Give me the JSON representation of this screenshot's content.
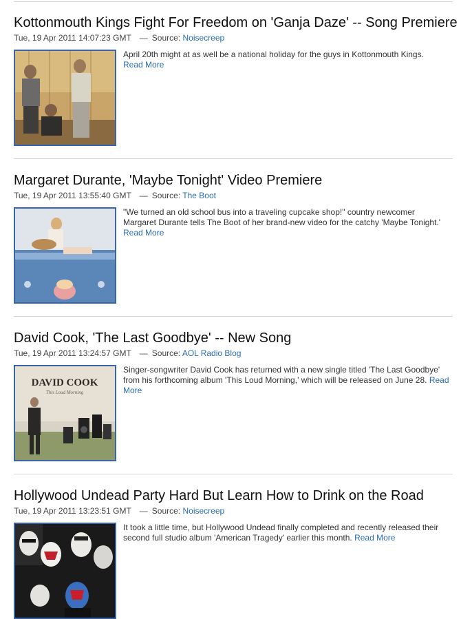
{
  "articles": [
    {
      "title": "Kottonmouth Kings Fight For Freedom on 'Ganja Daze' -- Song Premiere",
      "date": "Tue, 19 Apr 2011 14:07:23 GMT",
      "source_label": "Source:",
      "source": "Noisecreep",
      "summary": "April 20th might at as well be a national holiday for the guys in Kottonmouth Kings.",
      "read_more": "Read More"
    },
    {
      "title": "Margaret Durante, 'Maybe Tonight' Video Premiere",
      "date": "Tue, 19 Apr 2011 13:55:40 GMT",
      "source_label": "Source:",
      "source": "The Boot",
      "summary": "\"We turned an old school bus into a traveling cupcake shop!\" country newcomer Margaret Durante tells The Boot of her brand-new video for the catchy 'Maybe Tonight.'",
      "read_more": "Read More"
    },
    {
      "title": "David Cook, 'The Last Goodbye' -- New Song",
      "date": "Tue, 19 Apr 2011 13:24:57 GMT",
      "source_label": "Source:",
      "source": "AOL Radio Blog",
      "summary": "Singer-songwriter David Cook has returned with a new single titled 'The Last Goodbye' from his forthcoming album 'This Loud Morning,' which will be released on June 28.",
      "read_more": "Read More",
      "album_art_text": "DAVID COOK",
      "album_art_subtext": "This Loud Morning"
    },
    {
      "title": "Hollywood Undead Party Hard But Learn How to Drink on the Road",
      "date": "Tue, 19 Apr 2011 13:23:51 GMT",
      "source_label": "Source:",
      "source": "Noisecreep",
      "summary": "It took a little time, but Hollywood Undead finally completed and recently released their second full studio album 'American Tragedy' earlier this month.",
      "read_more": "Read More"
    }
  ],
  "separator": "—",
  "colors": {
    "link": "#2a6cb5",
    "thumb_border": "#3a64a8",
    "divider": "#d4d4d4"
  }
}
